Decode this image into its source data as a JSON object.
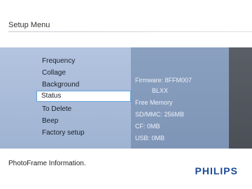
{
  "header": {
    "title": "Setup Menu"
  },
  "menu": {
    "items": [
      {
        "label": "Frequency"
      },
      {
        "label": "Collage"
      },
      {
        "label": "Background"
      },
      {
        "label": "Status",
        "selected": true
      },
      {
        "label": "To Delete"
      },
      {
        "label": "Beep"
      },
      {
        "label": "Factory setup"
      }
    ]
  },
  "info": {
    "firmware": "Firmware: 8FFM007",
    "firmware_code": "BLXX",
    "free_memory": "Free Memory",
    "sd_mmc": "SD/MMC: 256MB",
    "cf": "CF: 0MB",
    "usb": "USB: 0MB"
  },
  "footer": {
    "help_text": "PhotoFrame Information.",
    "brand": "PHILIPS"
  }
}
